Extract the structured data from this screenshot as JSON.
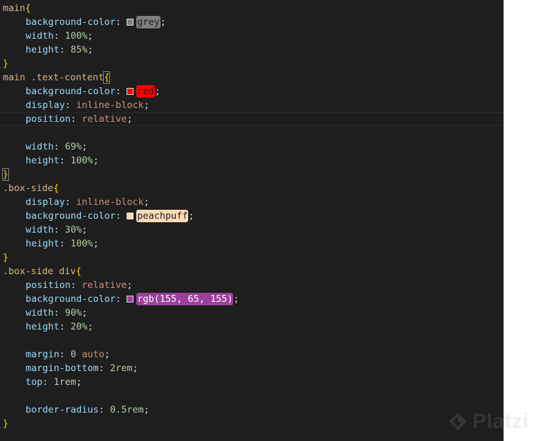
{
  "colors": {
    "background": "#1e1e1e",
    "selector": "#d7ba7d",
    "property": "#9cdcfe",
    "number": "#b5cea8",
    "keyword": "#ce9178",
    "brace": "#ffd700"
  },
  "watermark": {
    "text": "Platzi",
    "logo_icon": "platzi-logo-icon"
  },
  "code_lines": [
    {
      "indent": 0,
      "tokens": [
        {
          "t": "main",
          "c": "sel"
        },
        {
          "t": "{",
          "c": "brace"
        }
      ]
    },
    {
      "indent": 1,
      "tokens": [
        {
          "t": "background-color",
          "c": "prop"
        },
        {
          "t": ": ",
          "c": "punc"
        },
        {
          "t": "grey",
          "c": "color",
          "swatch": "#808080",
          "fg": "#1e1e1e"
        },
        {
          "t": ";",
          "c": "punc"
        }
      ]
    },
    {
      "indent": 1,
      "tokens": [
        {
          "t": "width",
          "c": "prop"
        },
        {
          "t": ": ",
          "c": "punc"
        },
        {
          "t": "100%",
          "c": "num"
        },
        {
          "t": ";",
          "c": "punc"
        }
      ]
    },
    {
      "indent": 1,
      "tokens": [
        {
          "t": "height",
          "c": "prop"
        },
        {
          "t": ": ",
          "c": "punc"
        },
        {
          "t": "85%",
          "c": "num"
        },
        {
          "t": ";",
          "c": "punc"
        }
      ]
    },
    {
      "indent": 0,
      "tokens": [
        {
          "t": "}",
          "c": "brace"
        }
      ]
    },
    {
      "indent": 0,
      "tokens": [
        {
          "t": "main .text-content",
          "c": "sel"
        },
        {
          "t": "{",
          "c": "brace match"
        }
      ]
    },
    {
      "indent": 1,
      "tokens": [
        {
          "t": "background-color",
          "c": "prop"
        },
        {
          "t": ": ",
          "c": "punc"
        },
        {
          "t": "red",
          "c": "color",
          "swatch": "#ff0000",
          "fg": "#1e1e1e"
        },
        {
          "t": ";",
          "c": "punc"
        }
      ]
    },
    {
      "indent": 1,
      "tokens": [
        {
          "t": "display",
          "c": "prop"
        },
        {
          "t": ": ",
          "c": "punc"
        },
        {
          "t": "inline-block",
          "c": "kw"
        },
        {
          "t": ";",
          "c": "punc"
        }
      ]
    },
    {
      "indent": 1,
      "current": true,
      "tokens": [
        {
          "t": "position",
          "c": "prop"
        },
        {
          "t": ": ",
          "c": "punc"
        },
        {
          "t": "relative",
          "c": "kw"
        },
        {
          "t": ";",
          "c": "punc"
        }
      ]
    },
    {
      "indent": 1,
      "tokens": []
    },
    {
      "indent": 1,
      "tokens": [
        {
          "t": "width",
          "c": "prop"
        },
        {
          "t": ": ",
          "c": "punc"
        },
        {
          "t": "69%",
          "c": "num"
        },
        {
          "t": ";",
          "c": "punc"
        }
      ]
    },
    {
      "indent": 1,
      "tokens": [
        {
          "t": "height",
          "c": "prop"
        },
        {
          "t": ": ",
          "c": "punc"
        },
        {
          "t": "100%",
          "c": "num"
        },
        {
          "t": ";",
          "c": "punc"
        }
      ]
    },
    {
      "indent": 0,
      "tokens": [
        {
          "t": "}",
          "c": "brace match"
        }
      ]
    },
    {
      "indent": 0,
      "tokens": [
        {
          "t": ".box-side",
          "c": "sel"
        },
        {
          "t": "{",
          "c": "brace"
        }
      ]
    },
    {
      "indent": 1,
      "tokens": [
        {
          "t": "display",
          "c": "prop"
        },
        {
          "t": ": ",
          "c": "punc"
        },
        {
          "t": "inline-block",
          "c": "kw"
        },
        {
          "t": ";",
          "c": "punc"
        }
      ]
    },
    {
      "indent": 1,
      "tokens": [
        {
          "t": "background-color",
          "c": "prop"
        },
        {
          "t": ": ",
          "c": "punc"
        },
        {
          "t": "peachpuff",
          "c": "color",
          "swatch": "#ffdab9",
          "fg": "#1e1e1e"
        },
        {
          "t": ";",
          "c": "punc"
        }
      ]
    },
    {
      "indent": 1,
      "tokens": [
        {
          "t": "width",
          "c": "prop"
        },
        {
          "t": ": ",
          "c": "punc"
        },
        {
          "t": "30%",
          "c": "num"
        },
        {
          "t": ";",
          "c": "punc"
        }
      ]
    },
    {
      "indent": 1,
      "tokens": [
        {
          "t": "height",
          "c": "prop"
        },
        {
          "t": ": ",
          "c": "punc"
        },
        {
          "t": "100%",
          "c": "num"
        },
        {
          "t": ";",
          "c": "punc"
        }
      ]
    },
    {
      "indent": 0,
      "tokens": [
        {
          "t": "}",
          "c": "brace"
        }
      ]
    },
    {
      "indent": 0,
      "tokens": [
        {
          "t": ".box-side div",
          "c": "sel"
        },
        {
          "t": "{",
          "c": "brace"
        }
      ]
    },
    {
      "indent": 1,
      "tokens": [
        {
          "t": "position",
          "c": "prop"
        },
        {
          "t": ": ",
          "c": "punc"
        },
        {
          "t": "relative",
          "c": "kw"
        },
        {
          "t": ";",
          "c": "punc"
        }
      ]
    },
    {
      "indent": 1,
      "tokens": [
        {
          "t": "background-color",
          "c": "prop"
        },
        {
          "t": ": ",
          "c": "punc"
        },
        {
          "t": "rgb(155, 65, 155)",
          "c": "color",
          "swatch": "#9b419b",
          "fg": "#ffffff"
        },
        {
          "t": ";",
          "c": "punc"
        }
      ]
    },
    {
      "indent": 1,
      "tokens": [
        {
          "t": "width",
          "c": "prop"
        },
        {
          "t": ": ",
          "c": "punc"
        },
        {
          "t": "90%",
          "c": "num"
        },
        {
          "t": ";",
          "c": "punc"
        }
      ]
    },
    {
      "indent": 1,
      "tokens": [
        {
          "t": "height",
          "c": "prop"
        },
        {
          "t": ": ",
          "c": "punc"
        },
        {
          "t": "20%",
          "c": "num"
        },
        {
          "t": ";",
          "c": "punc"
        }
      ]
    },
    {
      "indent": 1,
      "tokens": []
    },
    {
      "indent": 1,
      "tokens": [
        {
          "t": "margin",
          "c": "prop"
        },
        {
          "t": ": ",
          "c": "punc"
        },
        {
          "t": "0",
          "c": "num"
        },
        {
          "t": " ",
          "c": "punc"
        },
        {
          "t": "auto",
          "c": "kw"
        },
        {
          "t": ";",
          "c": "punc"
        }
      ]
    },
    {
      "indent": 1,
      "tokens": [
        {
          "t": "margin-bottom",
          "c": "prop"
        },
        {
          "t": ": ",
          "c": "punc"
        },
        {
          "t": "2rem",
          "c": "num"
        },
        {
          "t": ";",
          "c": "punc"
        }
      ]
    },
    {
      "indent": 1,
      "tokens": [
        {
          "t": "top",
          "c": "prop"
        },
        {
          "t": ": ",
          "c": "punc"
        },
        {
          "t": "1rem",
          "c": "num"
        },
        {
          "t": ";",
          "c": "punc"
        }
      ]
    },
    {
      "indent": 1,
      "tokens": []
    },
    {
      "indent": 1,
      "tokens": [
        {
          "t": "border-radius",
          "c": "prop"
        },
        {
          "t": ": ",
          "c": "punc"
        },
        {
          "t": "0.5rem",
          "c": "num"
        },
        {
          "t": ";",
          "c": "punc"
        }
      ]
    },
    {
      "indent": 0,
      "tokens": [
        {
          "t": "}",
          "c": "brace"
        }
      ]
    }
  ]
}
